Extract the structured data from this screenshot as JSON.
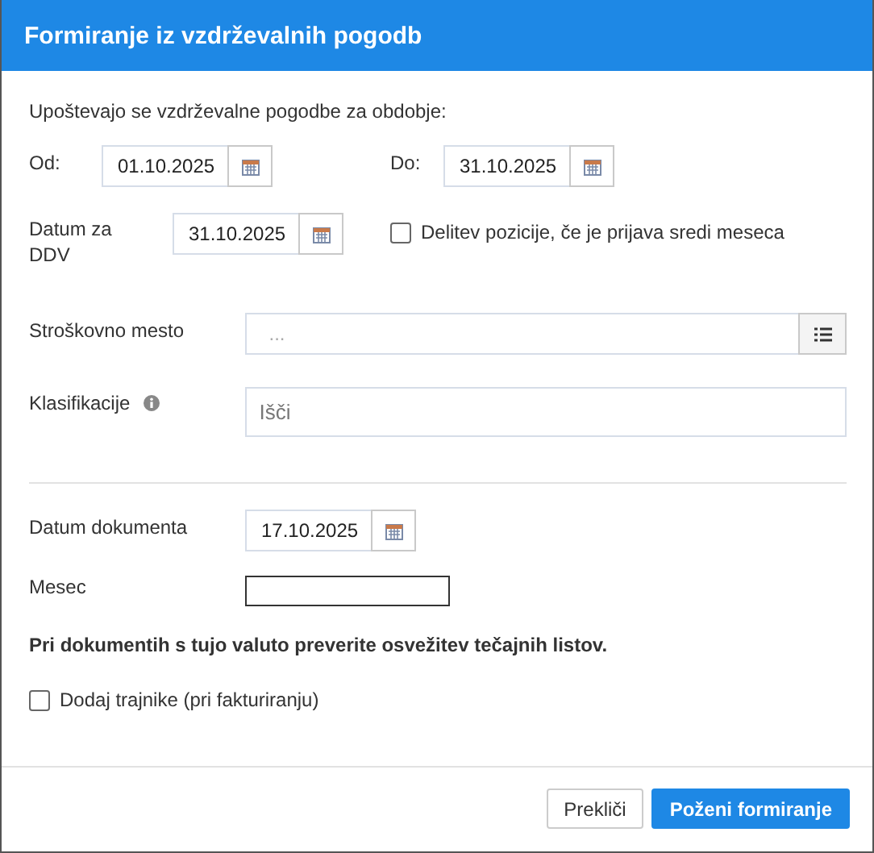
{
  "dialog": {
    "title": "Formiranje iz vzdrževalnih pogodb"
  },
  "intro": "Upoštevajo se vzdrževalne pogodbe za obdobje:",
  "period": {
    "from": {
      "label": "Od:",
      "value": "01.10.2025"
    },
    "to": {
      "label": "Do:",
      "value": "31.10.2025"
    }
  },
  "vat_date": {
    "label": "Datum za DDV",
    "value": "31.10.2025"
  },
  "split_checkbox": {
    "label": "Delitev pozicije, če je prijava sredi meseca",
    "checked": false
  },
  "cost_center": {
    "label": "Stroškovno mesto",
    "placeholder": "..."
  },
  "classifications": {
    "label": "Klasifikacije",
    "placeholder": "Išči"
  },
  "document_date": {
    "label": "Datum dokumenta",
    "value": "17.10.2025"
  },
  "month": {
    "label": "Mesec"
  },
  "notice": "Pri dokumentih s tujo valuto preverite osvežitev tečajnih listov.",
  "add_permanent": {
    "label": "Dodaj trajnike (pri fakturiranju)",
    "checked": false
  },
  "buttons": [
    {
      "label": "Prekliči",
      "kind": "secondary"
    },
    {
      "label": "Poženi formiranje",
      "kind": "primary"
    }
  ]
}
